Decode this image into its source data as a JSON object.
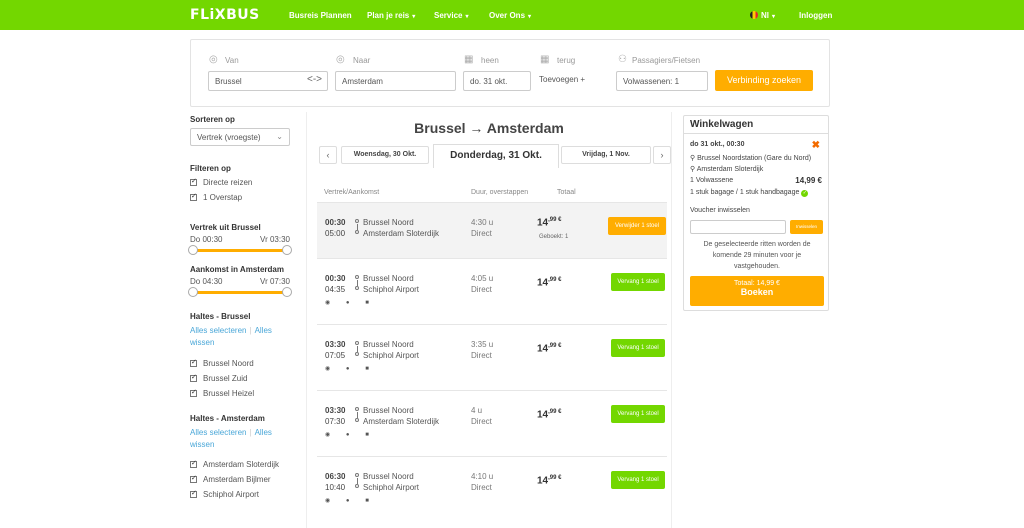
{
  "header": {
    "logo": "FLiXBUS",
    "nav": [
      "Busreis Plannen",
      "Plan je reis",
      "Service",
      "Over Ons"
    ],
    "language": "Nl",
    "login": "Inloggen"
  },
  "search": {
    "from_label": "Van",
    "from_value": "Brussel",
    "to_label": "Naar",
    "to_value": "Amsterdam",
    "out_label": "heen",
    "out_value": "do. 31 okt.",
    "return_label": "terug",
    "return_value": "Toevoegen",
    "pax_label": "Passagiers/Fietsen",
    "pax_value": "Volwassenen: 1",
    "search_button": "Verbinding zoeken"
  },
  "sidebar": {
    "sort_heading": "Sorteren op",
    "sort_value": "Vertrek (vroegste)",
    "filter_heading": "Filteren op",
    "filters": [
      "Directe reizen",
      "1 Overstap"
    ],
    "dep_heading": "Vertrek uit Brussel",
    "dep_from": "Do 00:30",
    "dep_to": "Vr 03:30",
    "arr_heading": "Aankomst in Amsterdam",
    "arr_from": "Do 04:30",
    "arr_to": "Vr 07:30",
    "stops_bru_heading": "Haltes - Brussel",
    "select_all": "Alles selecteren",
    "clear_all": "Alles wissen",
    "stops_bru": [
      "Brussel Noord",
      "Brussel Zuid",
      "Brussel Heizel"
    ],
    "stops_ams_heading": "Haltes - Amsterdam",
    "stops_ams": [
      "Amsterdam Sloterdijk",
      "Amsterdam Bijlmer",
      "Schiphol Airport"
    ]
  },
  "results": {
    "title": "Brussel → Amsterdam",
    "prev_day": "Woensdag, 30 Okt.",
    "current_day": "Donderdag, 31 Okt.",
    "next_day": "Vrijdag, 1 Nov.",
    "col_dep": "Vertrek/Aankomst",
    "col_dur": "Duur, overstappen",
    "col_total": "Totaal",
    "booked_label": "Geboekt: 1",
    "rides": [
      {
        "dep": "00:30",
        "arr": "05:00",
        "from": "Brussel Noord",
        "to": "Amsterdam Sloterdijk",
        "dur": "4:30 u",
        "type": "Direct",
        "price_main": "14",
        "price_dec": ",99 €",
        "button": "Verwijder 1 stoel"
      },
      {
        "dep": "00:30",
        "arr": "04:35",
        "from": "Brussel Noord",
        "to": "Schiphol Airport",
        "dur": "4:05 u",
        "type": "Direct",
        "price_main": "14",
        "price_dec": ",99 €",
        "button": "Vervang 1 stoel"
      },
      {
        "dep": "03:30",
        "arr": "07:05",
        "from": "Brussel Noord",
        "to": "Schiphol Airport",
        "dur": "3:35 u",
        "type": "Direct",
        "price_main": "14",
        "price_dec": ",99 €",
        "button": "Vervang 1 stoel"
      },
      {
        "dep": "03:30",
        "arr": "07:30",
        "from": "Brussel Noord",
        "to": "Amsterdam Sloterdijk",
        "dur": "4 u",
        "type": "Direct",
        "price_main": "14",
        "price_dec": ",99 €",
        "button": "Vervang 1 stoel"
      },
      {
        "dep": "06:30",
        "arr": "10:40",
        "from": "Brussel Noord",
        "to": "Schiphol Airport",
        "dur": "4:10 u",
        "type": "Direct",
        "price_main": "14",
        "price_dec": ",99 €",
        "button": "Vervang 1 stoel"
      }
    ],
    "amenities": "◉ ● ■"
  },
  "cart": {
    "title": "Winkelwagen",
    "date_time": "do 31 okt., 00:30",
    "from": "Brussel Noordstation (Gare du Nord)",
    "to": "Amsterdam Sloterdijk",
    "pax": "1 Volwassene",
    "price": "14,99 €",
    "baggage": "1 stuk bagage / 1 stuk handbagage",
    "voucher_label": "Voucher inwisselen",
    "voucher_button": "Inwisselen",
    "note": "De geselecteerde ritten worden de komende 29 minuten voor je vastgehouden.",
    "total": "Totaal: 14,99 €",
    "book_button": "Boeken"
  },
  "colors": {
    "brand_green": "#73d700",
    "accent_orange": "#ffad00"
  }
}
